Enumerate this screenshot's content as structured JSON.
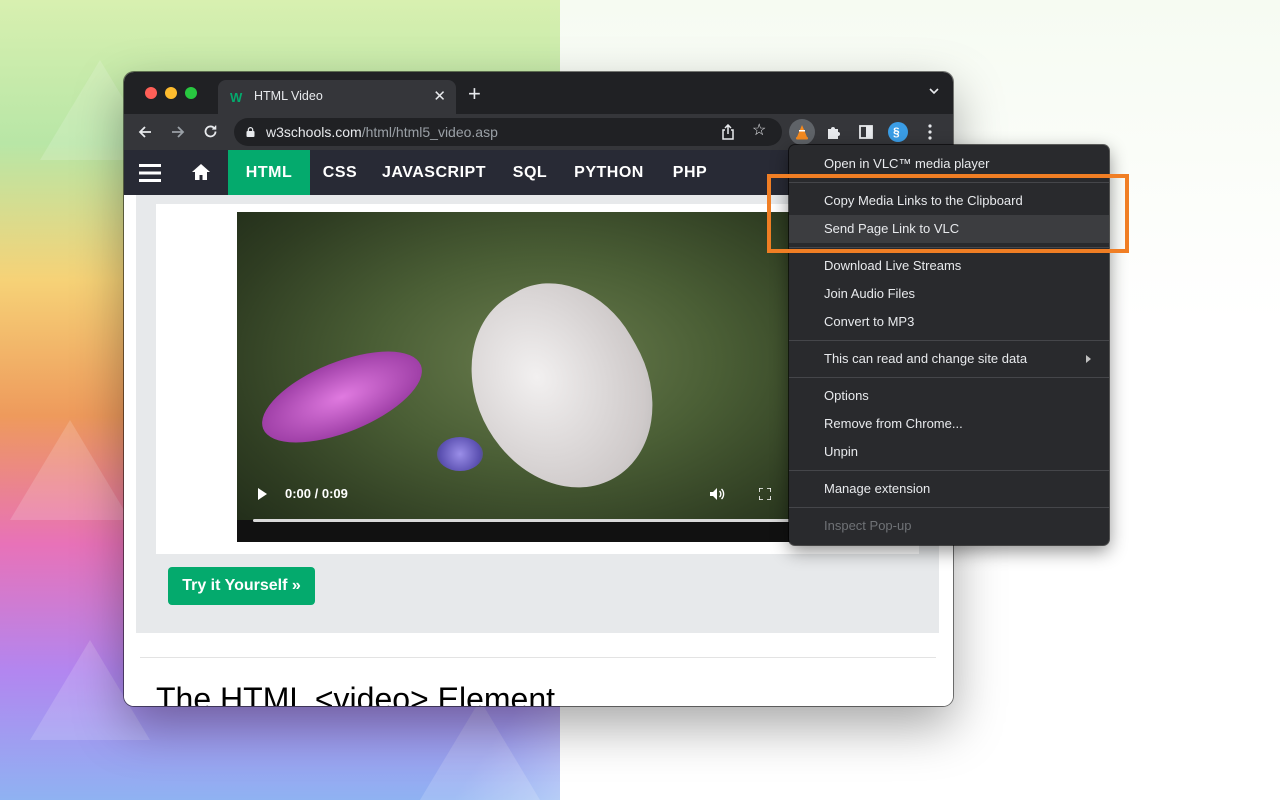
{
  "tab": {
    "title": "HTML Video"
  },
  "address_bar": {
    "host": "w3schools.com",
    "path": "/html/html5_video.asp"
  },
  "site_nav": {
    "items": [
      "HTML",
      "CSS",
      "JAVASCRIPT",
      "SQL",
      "PYTHON",
      "PHP"
    ],
    "active": "HTML"
  },
  "video": {
    "time": "0:00 / 0:09"
  },
  "try_button": "Try it Yourself »",
  "section_heading": "The HTML <video> Element",
  "context_menu": {
    "items": [
      {
        "label": "Open in VLC™ media player"
      },
      {
        "label": "Copy Media Links to the Clipboard"
      },
      {
        "label": "Send Page Link to VLC",
        "hovered": true
      },
      {
        "label": "Download Live Streams"
      },
      {
        "label": "Join Audio Files"
      },
      {
        "label": "Convert to MP3"
      },
      {
        "label": "This can read and change site data",
        "submenu": true
      },
      {
        "label": "Options"
      },
      {
        "label": "Remove from Chrome..."
      },
      {
        "label": "Unpin"
      },
      {
        "label": "Manage extension"
      },
      {
        "label": "Inspect Pop-up",
        "disabled": true
      }
    ]
  },
  "colors": {
    "w3_green": "#04aa6d",
    "w3_navbar": "#282a35",
    "highlight_orange": "#f07e24",
    "menu_bg": "#292a2d",
    "chrome_dark": "#202124"
  },
  "icons": {
    "traffic_lights": [
      "close-light",
      "minimize-light",
      "zoom-light"
    ],
    "toolbar": [
      "back-icon",
      "forward-icon",
      "reload-icon",
      "lock-icon",
      "share-icon",
      "bookmark-star-icon",
      "vlc-extension-icon",
      "extensions-puzzle-icon",
      "side-panel-icon",
      "profile-icon",
      "kebab-menu-icon"
    ]
  }
}
